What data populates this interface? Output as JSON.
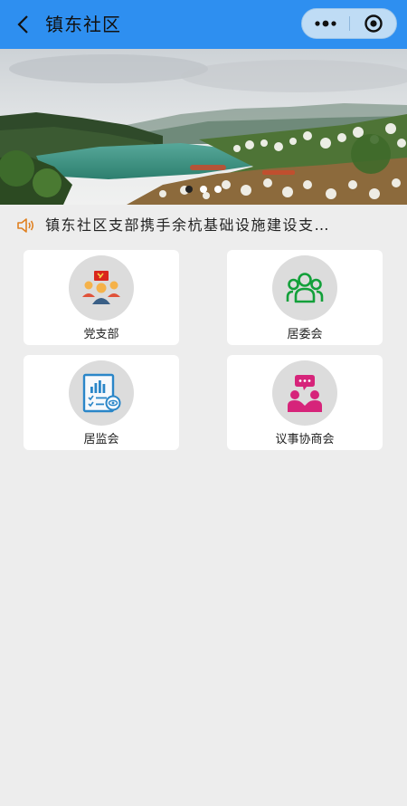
{
  "header": {
    "title": "镇东社区",
    "back_icon": "chevron-left-icon",
    "more_icon": "more-dots-icon",
    "target_icon": "target-icon",
    "bg_color": "#2e8ff0"
  },
  "banner": {
    "image": "lake-landscape-photo",
    "slide_count": 3,
    "active_slide": 1
  },
  "notice": {
    "icon": "speaker-icon",
    "text": "镇东社区支部携手余杭基础设施建设支…"
  },
  "grid": {
    "items": [
      {
        "label": "党支部",
        "icon": "party-branch-icon"
      },
      {
        "label": "居委会",
        "icon": "committee-group-icon"
      },
      {
        "label": "居监会",
        "icon": "supervision-report-icon"
      },
      {
        "label": "议事协商会",
        "icon": "discussion-meeting-icon"
      }
    ]
  }
}
